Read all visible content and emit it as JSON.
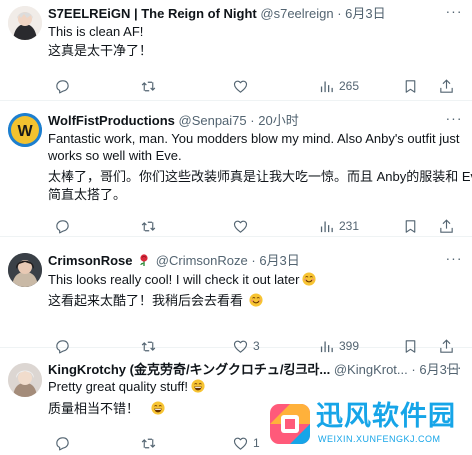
{
  "tweets": [
    {
      "name": "S7EELREiGN | The Reign of Night",
      "handle": "@s7eelreign",
      "time": "6月3日",
      "lines": [
        "This is clean AF!",
        "这真是太干净了！"
      ],
      "stats": {
        "reply": "",
        "retweet": "",
        "like": "",
        "views": "265"
      }
    },
    {
      "name": "WolfFistProductions",
      "handle": "@Senpai75",
      "time": "20小时",
      "lines": [
        "Fantastic work, man. You modders blow my mind. Also Anby's outfit just",
        "works so well with Eve.",
        "太棒了，哥们。你们这些改装师真是让我大吃一惊。而且 Anby的服装和 Eve",
        "简直太搭了。"
      ],
      "stats": {
        "reply": "",
        "retweet": "",
        "like": "",
        "views": "231"
      }
    },
    {
      "name": "CrimsonRose",
      "handle": "@CrimsonRoze",
      "time": "6月3日",
      "lines": [
        "This looks really cool! I will check it out later",
        "这看起来太酷了！我稍后会去看看"
      ],
      "stats": {
        "reply": "",
        "retweet": "",
        "like": "3",
        "views": "399"
      }
    },
    {
      "name": "KingKrotchy (金克劳奇/キングクロチュ/킹크라...",
      "handle": "@KingKrot...",
      "time": "6月3日",
      "lines": [
        "Pretty great quality stuff!",
        "质量相当不错！"
      ],
      "stats": {
        "reply": "",
        "retweet": "",
        "like": "1",
        "views": ""
      }
    }
  ],
  "icons": {
    "reply": "reply-icon",
    "retweet": "retweet-icon",
    "like": "heart-icon",
    "views": "views-icon",
    "bookmark": "bookmark-icon",
    "share": "share-icon",
    "more": "more-icon"
  },
  "colors": {
    "text": "#0f1419",
    "secondary": "#536471",
    "divider": "#eff3f4",
    "watermark": "#16a5e8",
    "wolffist_avatar": "#1d7fcf"
  },
  "watermark": {
    "title": "迅风软件园",
    "url": "WEIXIN.XUNFENGKJ.COM"
  }
}
